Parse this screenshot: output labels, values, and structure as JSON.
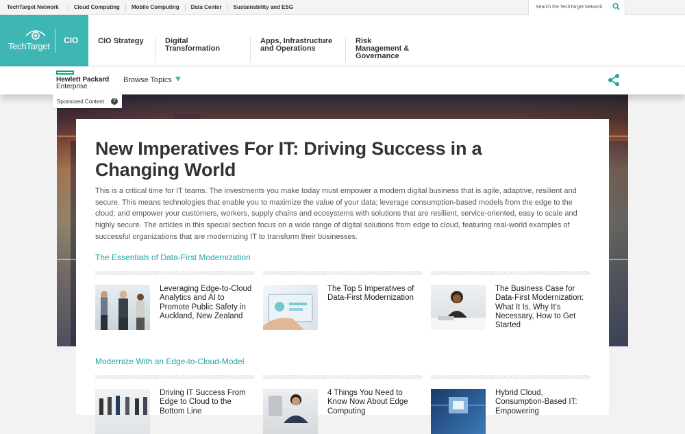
{
  "network_bar": {
    "links": [
      "TechTarget Network",
      "Cloud Computing",
      "Mobile Computing",
      "Data Center",
      "Sustainability and ESG"
    ],
    "search_placeholder": "Search the TechTarget Network"
  },
  "header": {
    "brand": "TechTarget",
    "site": "CIO",
    "nav": [
      "CIO Strategy",
      "Digital Transformation",
      "Apps, Infrastructure and Operations",
      "Risk Management & Governance"
    ]
  },
  "sponsor": {
    "name_line1": "Hewlett Packard",
    "name_line2": "Enterprise",
    "browse_label": "Browse Topics",
    "tag": "Sponsored Content",
    "tag_help": "?"
  },
  "main": {
    "title": "New Imperatives For IT: Driving Success in a Changing World",
    "intro": "This is a critical time for IT teams. The investments you make today must empower a modern digital business that is agile, adaptive, resilient and secure. This means technologies that enable you to maximize the value of your data; leverage consumption-based models from the edge to the cloud; and empower your customers, workers, supply chains and ecosystems with solutions that are resilient, service-oriented, easy to scale and highly secure. The articles in this special section focus on a wide range of digital solutions from edge to cloud, featuring real-world examples of successful organizations that are modernizing IT to transform their businesses.",
    "sections": [
      {
        "heading": "The Essentials of Data-First Modernization",
        "articles": [
          "Leveraging Edge-to-Cloud Analytics and AI to Promote Public Safety in Auckland, New Zealand",
          "The Top 5 Imperatives of Data-First Modernization",
          "The Business Case for Data-First Modernization: What It Is, Why It's Necessary, How to Get Started"
        ]
      },
      {
        "heading": "Modernize With an Edge-to-Cloud-Model",
        "articles": [
          "Driving IT Success From Edge to Cloud to the Bottom Line",
          "4 Things You Need to Know Now About Edge Computing",
          "Hybrid Cloud, Consumption-Based IT: Empowering"
        ]
      }
    ]
  },
  "colors": {
    "accent": "#3eb6b3",
    "section_heading": "#1fa6a4",
    "hpe_green": "#01a982"
  }
}
